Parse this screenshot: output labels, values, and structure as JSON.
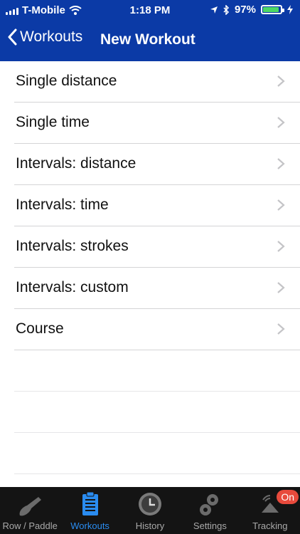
{
  "status_bar": {
    "carrier": "T-Mobile",
    "time": "1:18 PM",
    "battery": "97%"
  },
  "nav": {
    "back_label": "Workouts",
    "title": "New Workout"
  },
  "workout_types": [
    {
      "label": "Single distance"
    },
    {
      "label": "Single time"
    },
    {
      "label": "Intervals: distance"
    },
    {
      "label": "Intervals: time"
    },
    {
      "label": "Intervals: strokes"
    },
    {
      "label": "Intervals: custom"
    },
    {
      "label": "Course"
    }
  ],
  "tabbar": {
    "tabs": [
      {
        "label": "Row / Paddle",
        "icon": "oar-icon"
      },
      {
        "label": "Workouts",
        "icon": "clipboard-icon",
        "active": true
      },
      {
        "label": "History",
        "icon": "clock-icon"
      },
      {
        "label": "Settings",
        "icon": "gears-icon"
      },
      {
        "label": "Tracking",
        "icon": "tracking-icon",
        "badge": "On"
      }
    ]
  },
  "colors": {
    "header_bg": "#0b3aa6",
    "tab_active": "#2a8cf0",
    "badge": "#e84a3c"
  }
}
